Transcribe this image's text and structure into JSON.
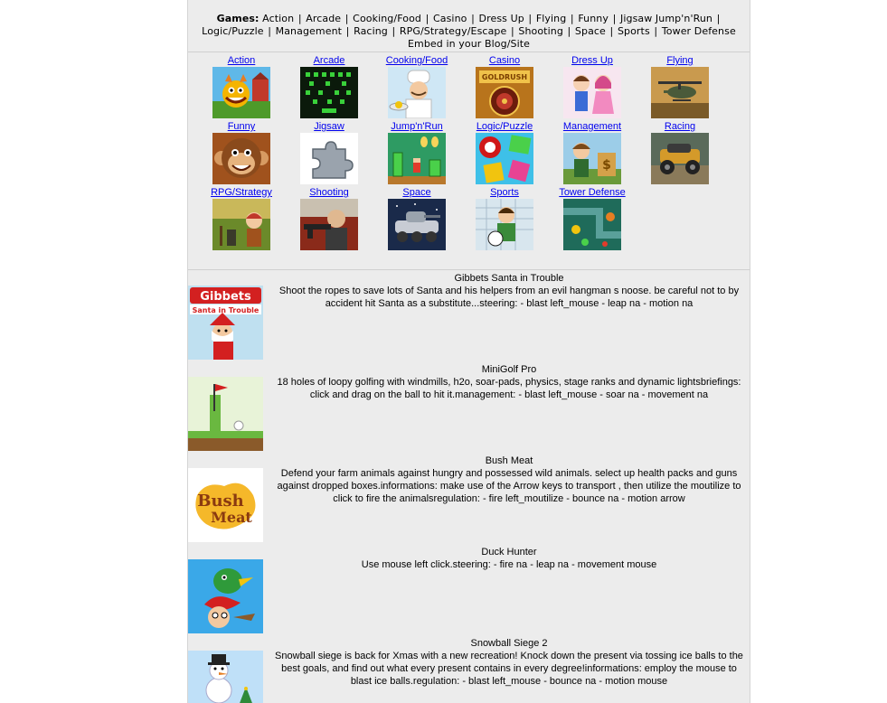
{
  "nav": {
    "lead": "Games:",
    "links": [
      "Action",
      "Arcade",
      "Cooking/Food",
      "Casino",
      "Dress Up",
      "Flying",
      "Funny",
      "Jigsaw Jump'n'Run",
      "Logic/Puzzle",
      "Management",
      "Racing",
      "RPG/Strategy/Escape",
      "Shooting",
      "Space",
      "Sports",
      "Tower Defense"
    ],
    "embed": "Embed in your Blog/Site"
  },
  "categories": [
    {
      "label": "Action",
      "icon": "action-game-icon"
    },
    {
      "label": "Arcade",
      "icon": "arcade-game-icon"
    },
    {
      "label": "Cooking/Food",
      "icon": "cooking-game-icon"
    },
    {
      "label": "Casino",
      "icon": "casino-game-icon"
    },
    {
      "label": "Dress Up",
      "icon": "dress-up-game-icon"
    },
    {
      "label": "Flying",
      "icon": "flying-game-icon"
    },
    {
      "label": "Funny",
      "icon": "funny-game-icon"
    },
    {
      "label": "Jigsaw",
      "icon": "jigsaw-game-icon"
    },
    {
      "label": "Jump'n'Run",
      "icon": "jump-run-game-icon"
    },
    {
      "label": "Logic/Puzzle",
      "icon": "logic-puzzle-game-icon"
    },
    {
      "label": "Management",
      "icon": "management-game-icon"
    },
    {
      "label": "Racing",
      "icon": "racing-game-icon"
    },
    {
      "label": "RPG/Strategy",
      "icon": "rpg-strategy-game-icon"
    },
    {
      "label": "Shooting",
      "icon": "shooting-game-icon"
    },
    {
      "label": "Space",
      "icon": "space-game-icon"
    },
    {
      "label": "Sports",
      "icon": "sports-game-icon"
    },
    {
      "label": "Tower Defense",
      "icon": "tower-defense-game-icon"
    }
  ],
  "games": [
    {
      "title": "Gibbets Santa in Trouble",
      "thumb_text_1": "Gibbets",
      "thumb_text_2": "Santa in Trouble",
      "description": "Shoot the ropes to save lots of Santa and his helpers from an evil hangman s noose. be careful not to by accident hit Santa as a substitute...steering: - blast left_mouse - leap na - motion na"
    },
    {
      "title": "MiniGolf Pro",
      "description": "18 holes of loopy golfing with windmills, h2o, soar-pads, physics, stage ranks and dynamic lightsbriefings: click and drag on the ball to hit it.management: - blast left_mouse - soar na - movement na"
    },
    {
      "title": "Bush Meat",
      "thumb_text_1": "Bush",
      "thumb_text_2": "Meat",
      "description": "Defend your farm animals against hungry and possessed wild animals. select up health packs and guns against dropped boxes.informations: make use of the Arrow keys to transport , then utilize the moutilize to click to fire the animalsregulation: - fire left_moutilize - bounce na - motion arrow"
    },
    {
      "title": "Duck Hunter",
      "description": "Use mouse left click.steering: - fire na - leap na - movement mouse"
    },
    {
      "title": "Snowball Siege 2",
      "description": "Snowball siege is back for Xmas with a new recreation! Knock down the present via tossing ice balls to the best goals, and find out what every present contains in every degree!informations: employ the mouse to blast ice balls.regulation: - blast left_mouse - bounce na - motion mouse"
    }
  ],
  "colors": {
    "panel_bg": "#ececec",
    "page_bg": "#ffffff",
    "text": "#000000"
  }
}
